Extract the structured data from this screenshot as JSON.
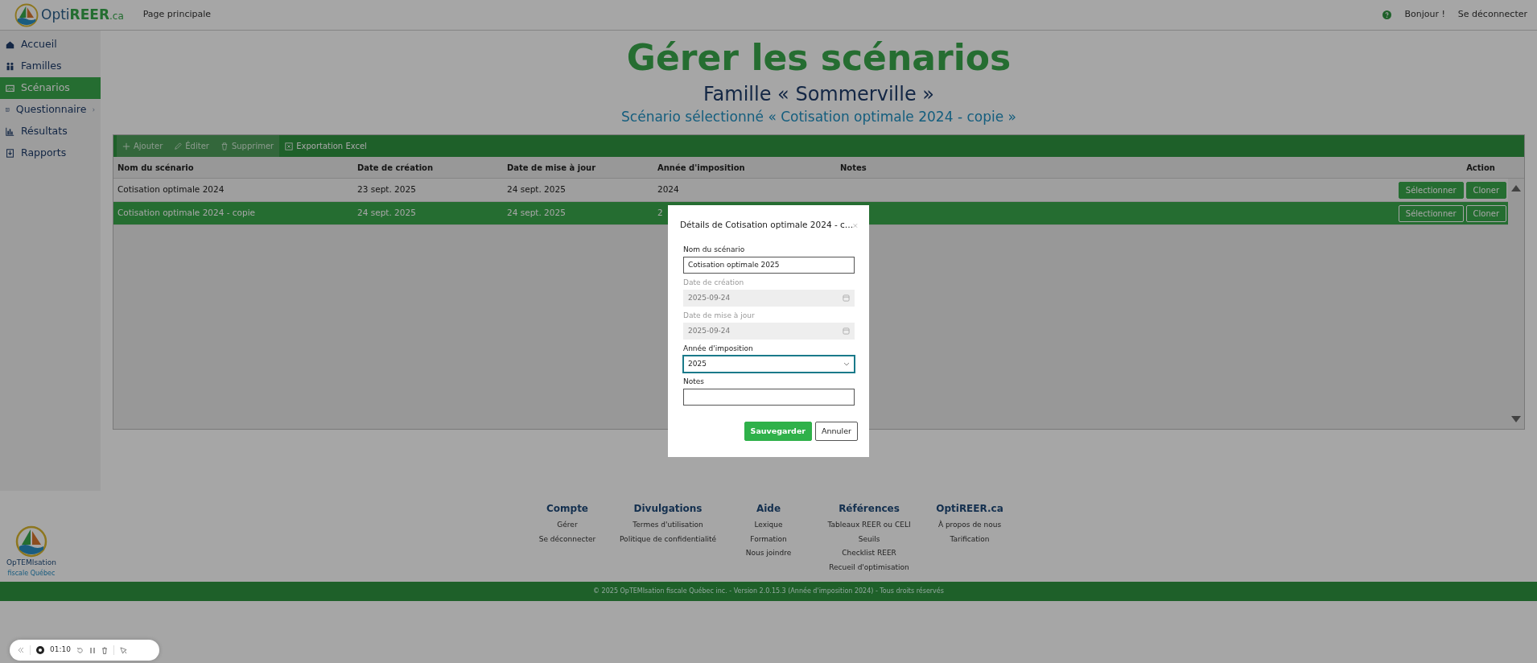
{
  "navbar": {
    "brand": [
      "Opti",
      "REER",
      ".ca"
    ],
    "link": "Page principale",
    "greeting": "Bonjour !",
    "logout": "Se déconnecter"
  },
  "sidebar": {
    "items": [
      {
        "label": "Accueil",
        "selected": false,
        "expandable": false
      },
      {
        "label": "Familles",
        "selected": false,
        "expandable": false
      },
      {
        "label": "Scénarios",
        "selected": true,
        "expandable": false
      },
      {
        "label": "Questionnaire",
        "selected": false,
        "expandable": true
      },
      {
        "label": "Résultats",
        "selected": false,
        "expandable": false
      },
      {
        "label": "Rapports",
        "selected": false,
        "expandable": false
      }
    ]
  },
  "header": {
    "title": "Gérer les scénarios",
    "family": "Famille « Sommerville »",
    "scenario": "Scénario sélectionné « Cotisation optimale 2024 - copie »"
  },
  "toolbar": [
    {
      "label": "Ajouter",
      "disabled": true
    },
    {
      "label": "Éditer",
      "disabled": true
    },
    {
      "label": "Supprimer",
      "disabled": true
    },
    {
      "label": "Exportation Excel",
      "disabled": false
    }
  ],
  "table": {
    "columns": [
      "Nom du scénario",
      "Date de création",
      "Date de mise à jour",
      "Année d'imposition",
      "Notes",
      "Action"
    ],
    "rows": [
      {
        "cells": [
          "Cotisation optimale 2024",
          "23 sept. 2025",
          "24 sept. 2025",
          "2024"
        ],
        "selected": false,
        "actions": [
          "Sélectionner",
          "Cloner"
        ]
      },
      {
        "cells": [
          "Cotisation optimale 2024 - copie",
          "24 sept. 2025",
          "24 sept. 2025",
          "2"
        ],
        "selected": true,
        "actions": [
          "Sélectionner",
          "Cloner"
        ]
      }
    ]
  },
  "modal": {
    "title": "Détails de Cotisation optimale 2024 - c…",
    "fields": [
      {
        "kind": "text",
        "label": "Nom du scénario",
        "value": "Cotisation optimale 2025",
        "disabled": false,
        "focused": false
      },
      {
        "kind": "date",
        "label": "Date de création",
        "value": "2025-09-24",
        "disabled": true,
        "focused": false
      },
      {
        "kind": "date",
        "label": "Date de mise à jour",
        "value": "2025-09-24",
        "disabled": true,
        "focused": false
      },
      {
        "kind": "select",
        "label": "Année d'imposition",
        "value": "2025",
        "disabled": false,
        "focused": true
      },
      {
        "kind": "text",
        "label": "Notes",
        "disabled": false,
        "focused": false
      }
    ],
    "buttons": [
      {
        "label": "Sauvegarder",
        "kind": "primary"
      },
      {
        "label": "Annuler",
        "kind": "outline"
      }
    ]
  },
  "footer": {
    "logo": {
      "name": "OpTEMIsation",
      "tagline": "fiscale Québec"
    },
    "columns": [
      {
        "heading": "Compte",
        "links": [
          "Gérer",
          "Se déconnecter"
        ]
      },
      {
        "heading": "Divulgations",
        "links": [
          "Termes d'utilisation",
          "Politique de confidentialité"
        ]
      },
      {
        "heading": "Aide",
        "links": [
          "Lexique",
          "Formation",
          "Nous joindre"
        ]
      },
      {
        "heading": "Références",
        "links": [
          "Tableaux REER ou CELI",
          "Seuils",
          "Checklist REER",
          "Recueil d'optimisation"
        ]
      },
      {
        "heading": "OptiREER.ca",
        "links": [
          "À propos de nous",
          "Tarification"
        ]
      }
    ],
    "copyright": "© 2025 OpTEMIsation fiscale Québec inc. - Version 2.0.15.3 (Année d'imposition 2024) - Tous droits réservés"
  },
  "recorder": {
    "time": "01:10"
  }
}
